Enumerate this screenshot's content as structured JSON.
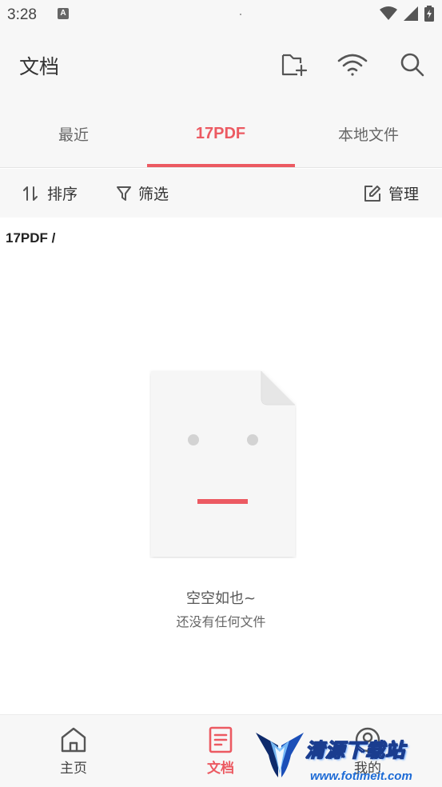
{
  "status_bar": {
    "time": "3:28",
    "notification_letter": "A"
  },
  "header": {
    "title": "文档",
    "icons": [
      "new-folder-icon",
      "wifi-transfer-icon",
      "search-icon"
    ]
  },
  "tabs": [
    {
      "label": "最近",
      "active": false
    },
    {
      "label": "17PDF",
      "active": true
    },
    {
      "label": "本地文件",
      "active": false
    }
  ],
  "toolbar": {
    "sort_label": "排序",
    "filter_label": "筛选",
    "manage_label": "管理"
  },
  "breadcrumb": "17PDF /",
  "empty_state": {
    "title": "空空如也~",
    "subtitle": "还没有任何文件"
  },
  "bottom_nav": [
    {
      "label": "主页",
      "icon": "home-icon",
      "active": false
    },
    {
      "label": "文档",
      "icon": "document-icon",
      "active": true
    },
    {
      "label": "我的",
      "icon": "profile-icon",
      "active": false
    }
  ],
  "watermark": {
    "title": "清源下载站",
    "url": "www.fotimeit.com"
  },
  "colors": {
    "accent": "#ec5a62",
    "background": "#f7f7f7"
  }
}
